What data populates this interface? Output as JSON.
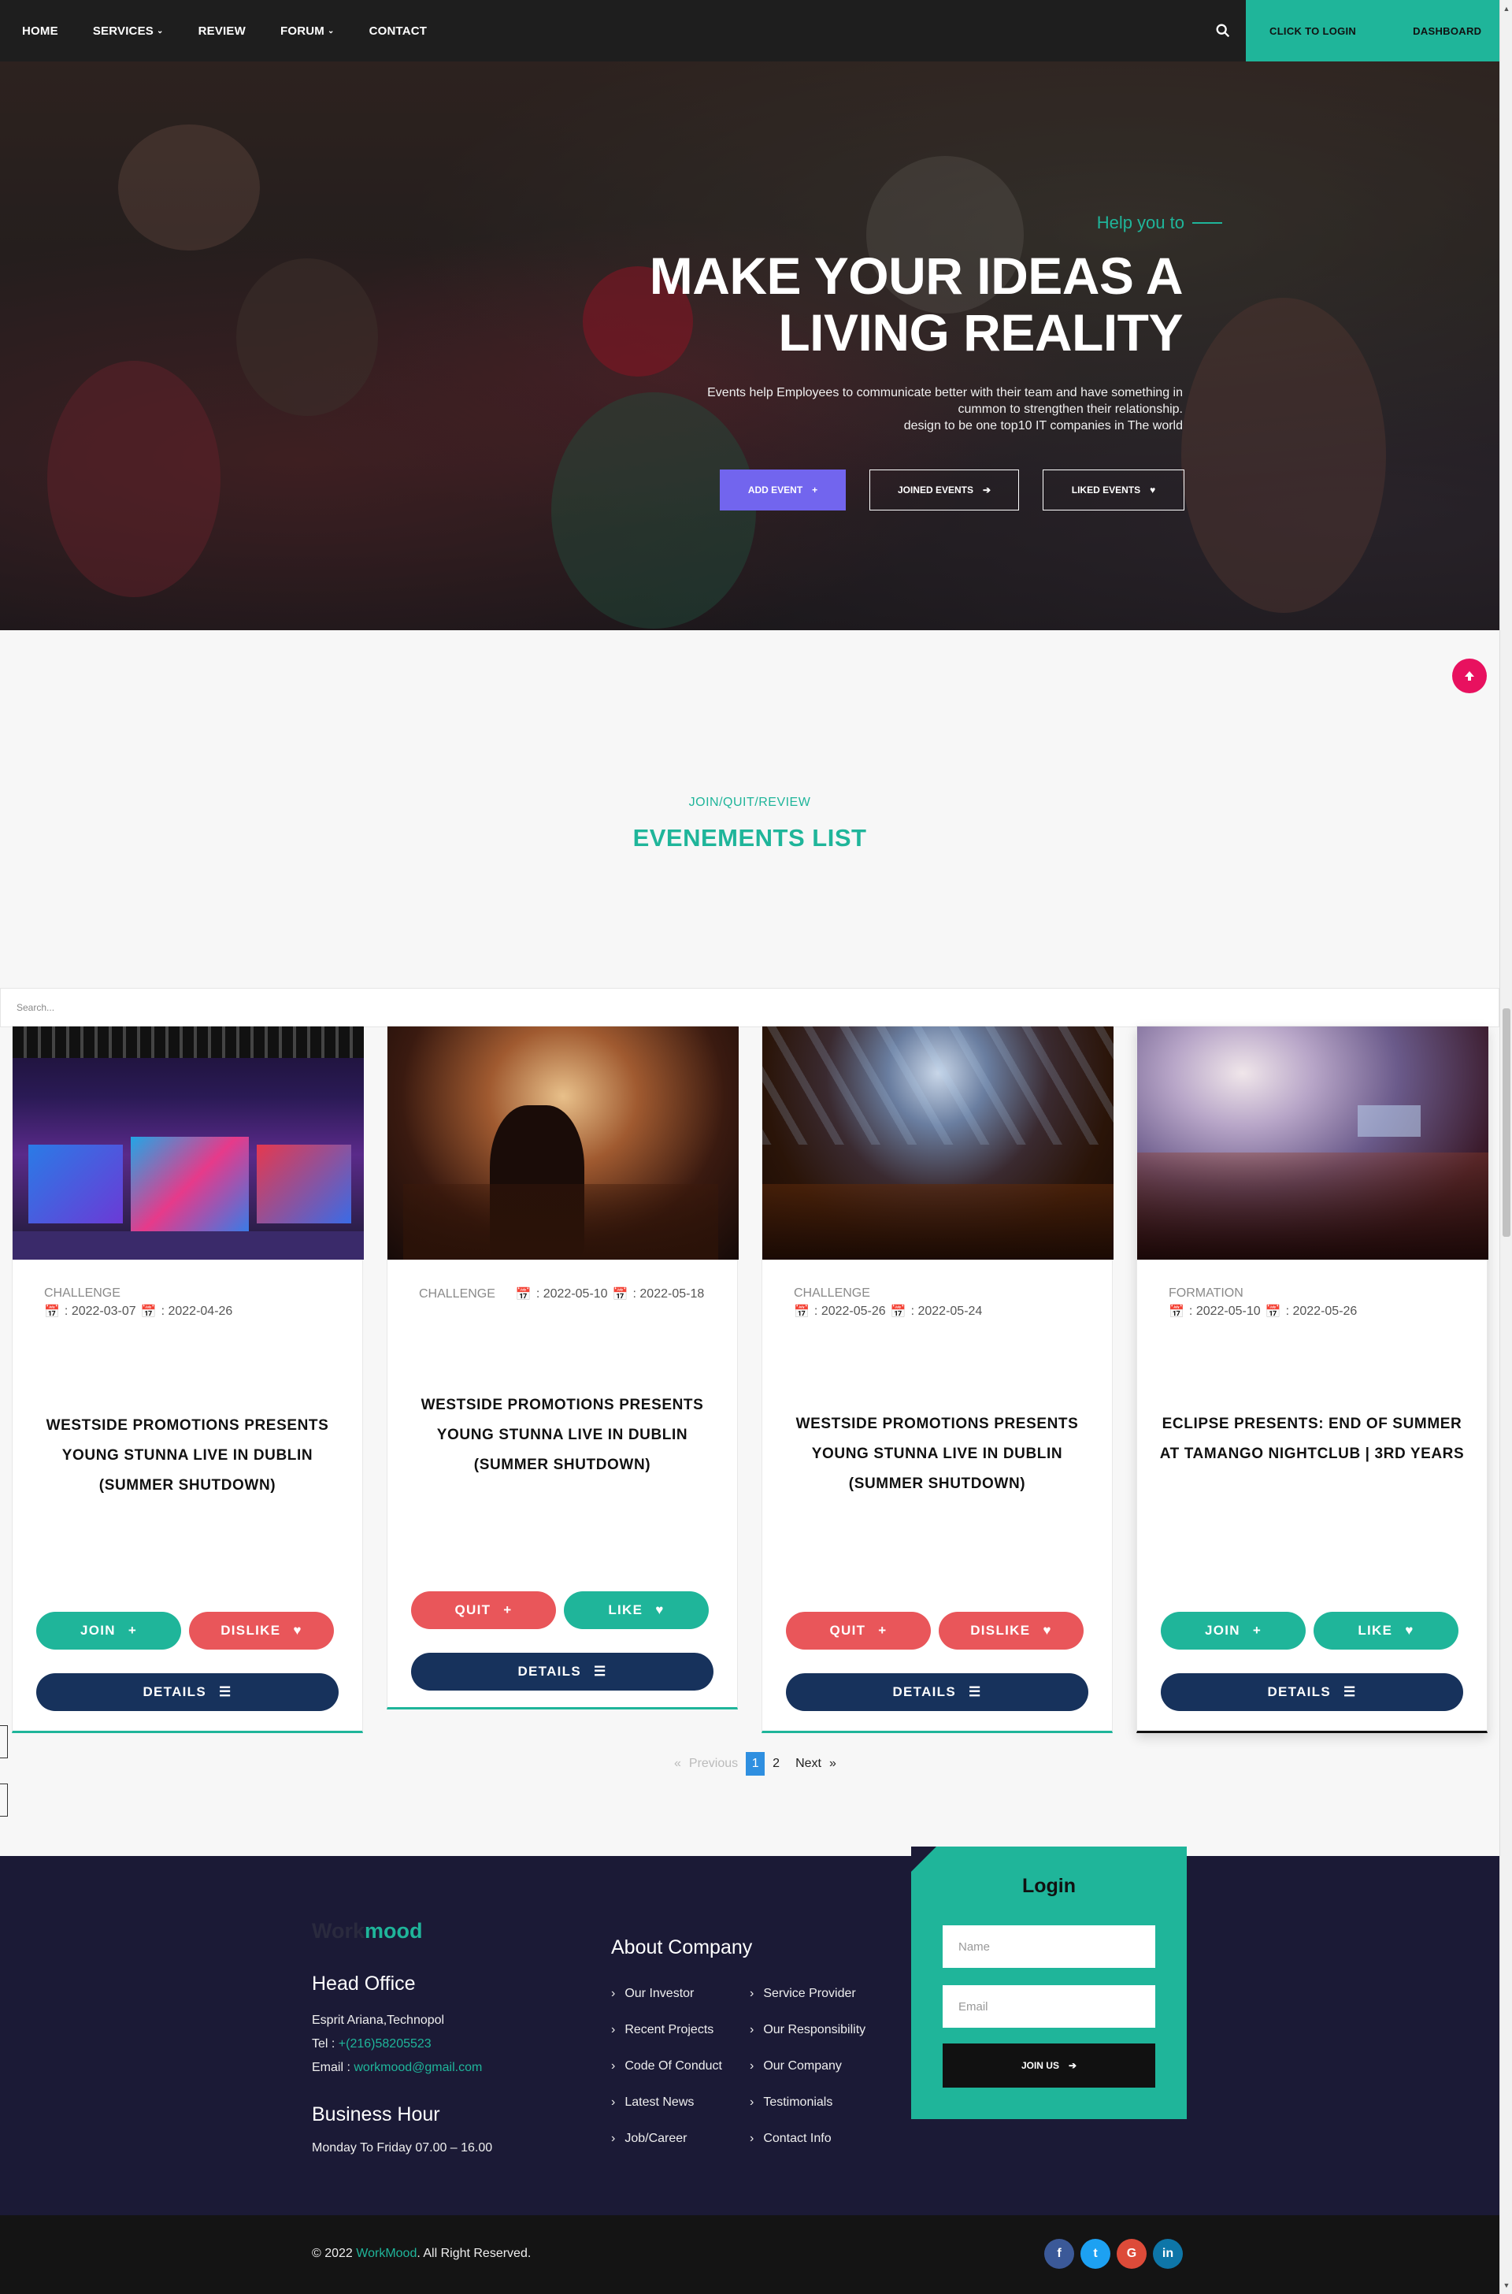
{
  "nav": {
    "items": [
      {
        "label": "HOME"
      },
      {
        "label": "SERVICES"
      },
      {
        "label": "REVIEW"
      },
      {
        "label": "FORUM"
      },
      {
        "label": "CONTACT"
      }
    ],
    "login_label": "CLICK TO LOGIN",
    "dashboard_label": "DASHBOARD"
  },
  "hero": {
    "subtitle": "Help you to",
    "title_line1": "MAKE YOUR IDEAS A",
    "title_line2": "LIVING REALITY",
    "desc_line1": "Events help Employees to communicate better with their team and have something in",
    "desc_line2": "cummon to strengthen their relationship.",
    "desc_line3": "design to be one top10 IT companies in The world",
    "btn_add": "ADD EVENT",
    "btn_joined": "JOINED EVENTS",
    "btn_liked": "LIKED EVENTS"
  },
  "section": {
    "kicker": "JOIN/QUIT/REVIEW",
    "title": "EVENEMENTS LIST"
  },
  "search": {
    "placeholder": "Search..."
  },
  "events": [
    {
      "category": "CHALLENGE",
      "start": ": 2022-03-07",
      "end": ": 2022-04-26",
      "title": "WESTSIDE PROMOTIONS PRESENTS YOUNG STUNNA LIVE IN DUBLIN (SUMMER SHUTDOWN)",
      "btn1": "JOIN",
      "btn2": "DISLIKE",
      "details": "DETAILS"
    },
    {
      "category": "CHALLENGE",
      "start": ": 2022-05-10",
      "end": ": 2022-05-18",
      "title": "WESTSIDE PROMOTIONS PRESENTS YOUNG STUNNA LIVE IN DUBLIN (SUMMER SHUTDOWN)",
      "btn1": "QUIT",
      "btn2": "LIKE",
      "details": "DETAILS"
    },
    {
      "category": "CHALLENGE",
      "start": ": 2022-05-26",
      "end": ": 2022-05-24",
      "title": "WESTSIDE PROMOTIONS PRESENTS YOUNG STUNNA LIVE IN DUBLIN (SUMMER SHUTDOWN)",
      "btn1": "QUIT",
      "btn2": "DISLIKE",
      "details": "DETAILS"
    },
    {
      "category": "FORMATION",
      "start": ": 2022-05-10",
      "end": ": 2022-05-26",
      "title": "ECLIPSE PRESENTS: END OF SUMMER AT TAMANGO NIGHTCLUB | 3RD YEARS",
      "btn1": "JOIN",
      "btn2": "LIKE",
      "details": "DETAILS"
    }
  ],
  "pagination": {
    "prev": "Previous",
    "page1": "1",
    "page2": "2",
    "next": "Next"
  },
  "footer": {
    "brand_a": "Work",
    "brand_b": "mood",
    "office_title": "Head Office",
    "address": "Esprit Ariana,Technopol",
    "tel_label": "Tel :",
    "tel": "+(216)58205523",
    "email_label": "Email :",
    "email": "workmood@gmail.com",
    "hours_title": "Business Hour",
    "hours": "Monday To Friday 07.00 – 16.00",
    "about_title": "About Company",
    "links_col1": [
      "Our Investor",
      "Recent Projects",
      "Code Of Conduct",
      "Latest News",
      "Job/Career"
    ],
    "links_col2": [
      "Service Provider",
      "Our Responsibility",
      "Our Company",
      "Testimonials",
      "Contact Info"
    ],
    "login_title": "Login",
    "name_placeholder": "Name",
    "email_placeholder": "Email",
    "join_label": "JOIN US",
    "copyright_a": "© 2022 ",
    "copyright_brand": "WorkMood",
    "copyright_b": ". All Right Reserved.",
    "social": [
      {
        "label": "f",
        "color": "#3b5998"
      },
      {
        "label": "t",
        "color": "#1da1f2"
      },
      {
        "label": "G",
        "color": "#dd4b39"
      },
      {
        "label": "in",
        "color": "#0e76a8"
      }
    ]
  }
}
